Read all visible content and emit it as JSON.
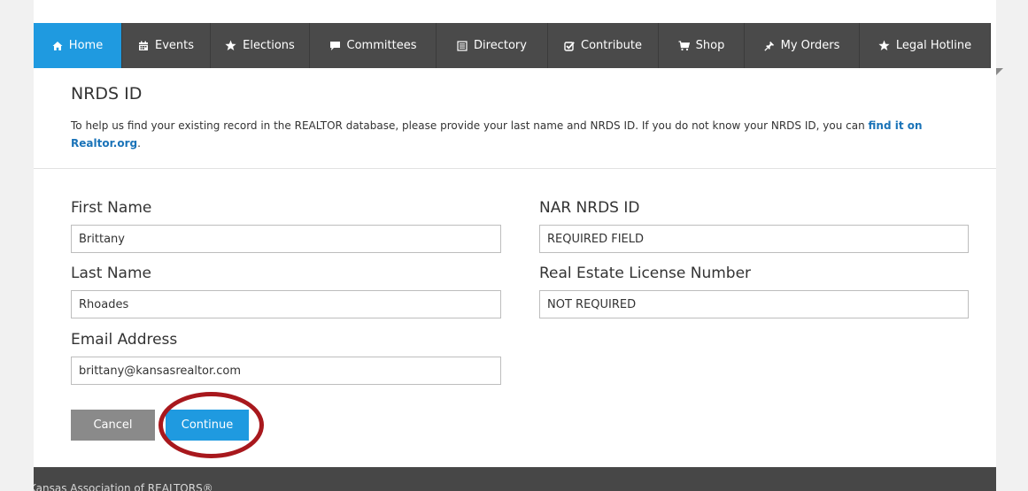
{
  "nav": {
    "items": [
      {
        "label": "Home",
        "icon": "home-icon",
        "active": true
      },
      {
        "label": "Events",
        "icon": "calendar-icon"
      },
      {
        "label": "Elections",
        "icon": "star-icon"
      },
      {
        "label": "Committees",
        "icon": "chat-bubble-icon"
      },
      {
        "label": "Directory",
        "icon": "list-icon"
      },
      {
        "label": "Contribute",
        "icon": "checkbox-icon"
      },
      {
        "label": "Shop",
        "icon": "cart-icon"
      },
      {
        "label": "My Orders",
        "icon": "pin-icon"
      },
      {
        "label": "Legal Hotline",
        "icon": "star-icon"
      }
    ]
  },
  "section": {
    "title": "NRDS ID",
    "intro_text": "To help us find your existing record in the REALTOR database, please provide your last name and NRDS ID. If you do not know your NRDS ID, you can ",
    "intro_link": "find it on Realtor.org",
    "intro_end": "."
  },
  "form": {
    "first_name": {
      "label": "First Name",
      "value": "Brittany"
    },
    "last_name": {
      "label": "Last Name",
      "value": "Rhoades"
    },
    "email": {
      "label": "Email Address",
      "value": "brittany@kansasrealtor.com"
    },
    "nrds_id": {
      "label": "NAR NRDS ID",
      "placeholder": "REQUIRED FIELD"
    },
    "license": {
      "label": "Real Estate License Number",
      "placeholder": "NOT REQUIRED"
    }
  },
  "buttons": {
    "cancel": "Cancel",
    "continue": "Continue"
  },
  "footer": {
    "text": "Kansas Association of REALTORS®"
  },
  "colors": {
    "nav_bg": "#4a4a4a",
    "accent": "#1f9ae0",
    "highlight_circle": "#a8181d",
    "link": "#1a73b8"
  }
}
